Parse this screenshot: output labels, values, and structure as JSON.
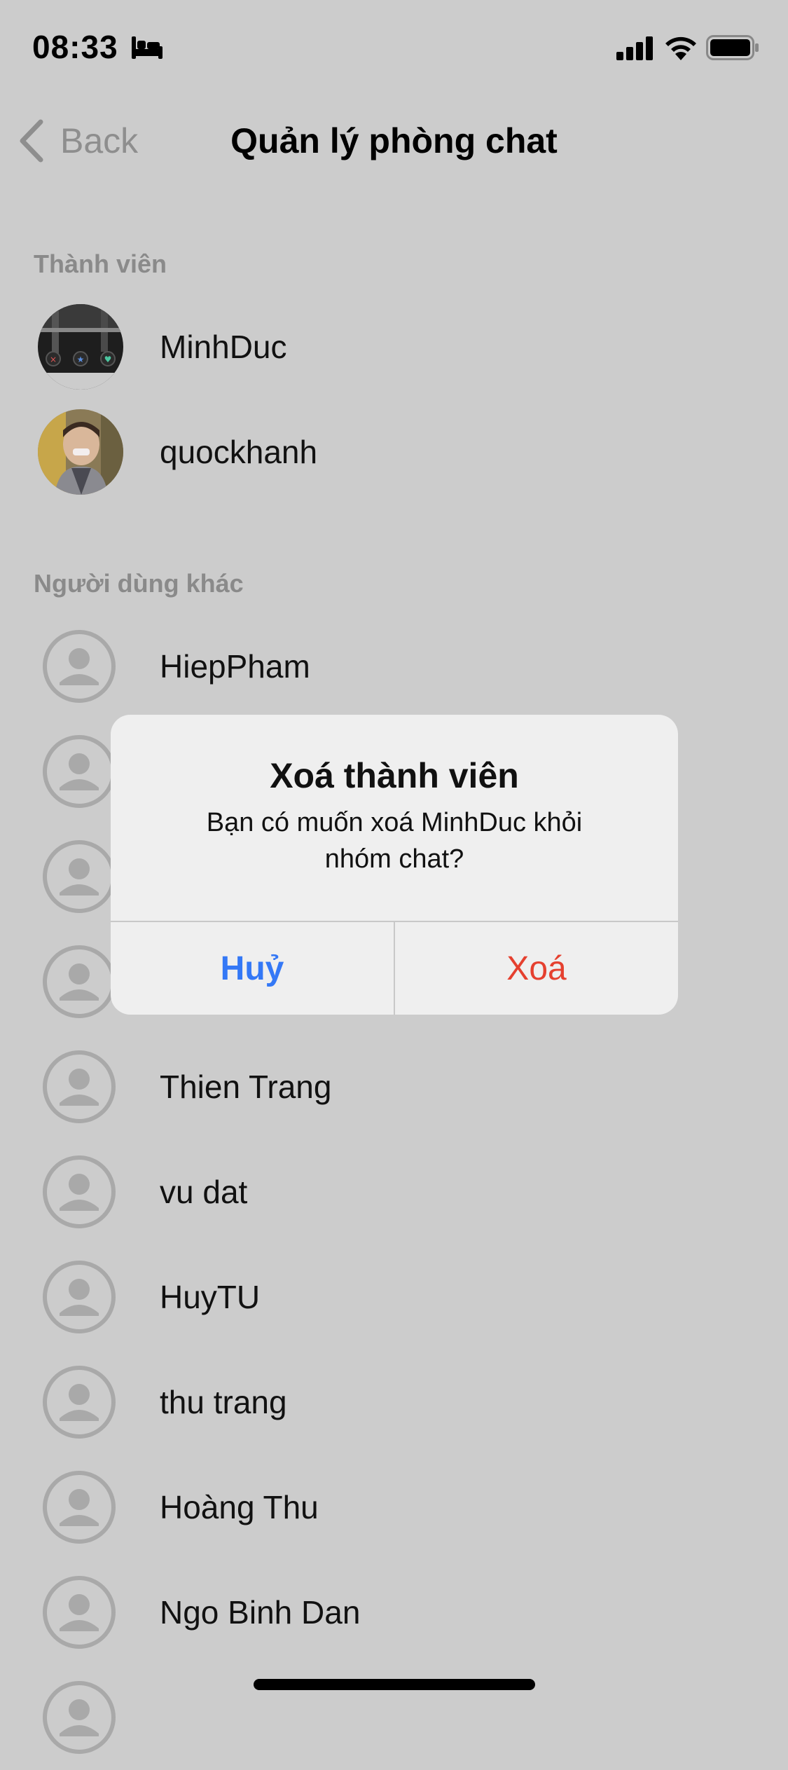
{
  "status_bar": {
    "time": "08:33"
  },
  "nav": {
    "back_label": "Back",
    "title": "Quản lý phòng chat"
  },
  "members_section": {
    "header": "Thành viên",
    "members": [
      {
        "name": "MinhDuc"
      },
      {
        "name": "quockhanh"
      }
    ]
  },
  "others_section": {
    "header": "Người dùng khác",
    "users": [
      {
        "name": "HiepPham"
      },
      {
        "name": ""
      },
      {
        "name": ""
      },
      {
        "name": ""
      },
      {
        "name": "Thien Trang"
      },
      {
        "name": "vu dat"
      },
      {
        "name": "HuyTU"
      },
      {
        "name": "thu trang"
      },
      {
        "name": "Hoàng Thu"
      },
      {
        "name": "Ngo Binh Dan"
      }
    ]
  },
  "alert": {
    "title": "Xoá thành viên",
    "message": "Bạn có muốn xoá MinhDuc khỏi nhóm chat?",
    "cancel_label": "Huỷ",
    "delete_label": "Xoá"
  },
  "colors": {
    "accent": "#3478f6",
    "destructive": "#e5402f",
    "background": "#cccccc"
  }
}
